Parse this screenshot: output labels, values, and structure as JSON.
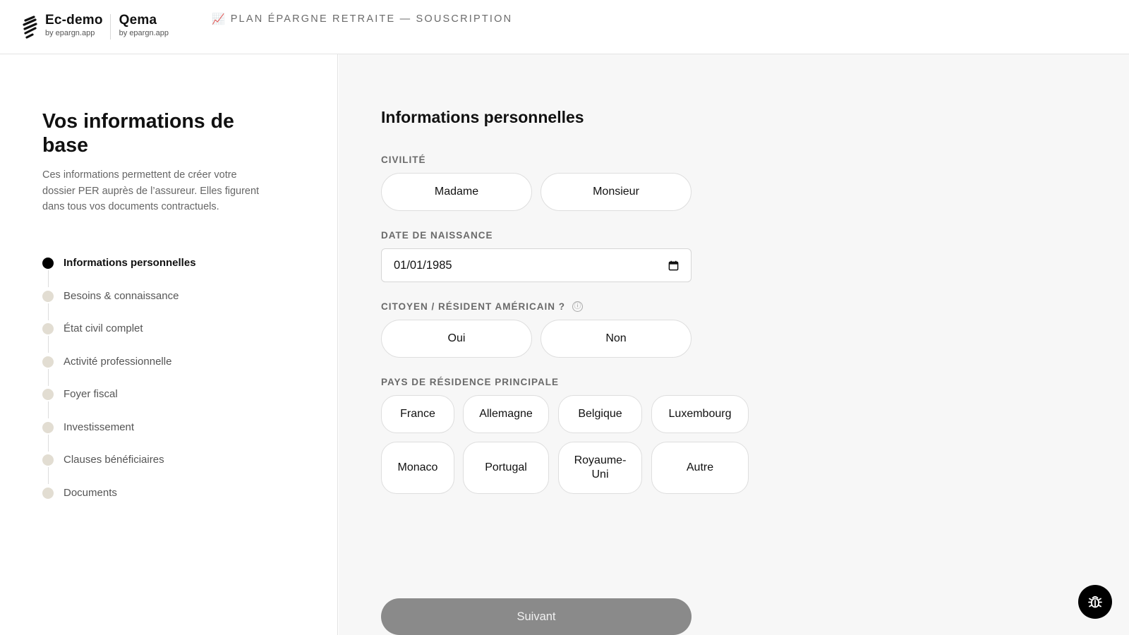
{
  "header": {
    "brand_1": {
      "name": "Ec-demo",
      "sub": "by epargn.app"
    },
    "brand_2": {
      "name": "Qema",
      "sub": "by epargn.app"
    },
    "product_icon": "📈",
    "product_title": "PLAN ÉPARGNE RETRAITE — SOUSCRIPTION"
  },
  "sidebar": {
    "title": "Vos informations de base",
    "description": "Ces informations permettent de créer votre dossier PER auprès de l’assureur. Elles figurent dans tous vos documents contractuels.",
    "steps": [
      {
        "label": "Informations personnelles",
        "active": true
      },
      {
        "label": "Besoins & connaissance",
        "active": false
      },
      {
        "label": "État civil complet",
        "active": false
      },
      {
        "label": "Activité professionnelle",
        "active": false
      },
      {
        "label": "Foyer fiscal",
        "active": false
      },
      {
        "label": "Investissement",
        "active": false
      },
      {
        "label": "Clauses bénéficiaires",
        "active": false
      },
      {
        "label": "Documents",
        "active": false
      }
    ]
  },
  "form": {
    "title": "Informations personnelles",
    "civilite": {
      "label": "CIVILITÉ",
      "options": [
        "Madame",
        "Monsieur"
      ]
    },
    "birth_date": {
      "label": "DATE DE NAISSANCE",
      "value": "01/01/1985"
    },
    "us_person": {
      "label": "CITOYEN / RÉSIDENT AMÉRICAIN ?",
      "info_icon": "ⓘ",
      "options": [
        "Oui",
        "Non"
      ]
    },
    "country": {
      "label": "PAYS DE RÉSIDENCE PRINCIPALE",
      "options": [
        "France",
        "Allemagne",
        "Belgique",
        "Luxembourg",
        "Monaco",
        "Portugal",
        "Royaume-Uni",
        "Autre"
      ]
    },
    "next_label": "Suivant"
  },
  "colors": {
    "accent": "#000000",
    "next_button_disabled": "#8a8a8a",
    "inactive_dot": "#e2ddd2",
    "right_panel_bg": "#f7f7f7"
  },
  "icons": {
    "logo": "brand-logo-icon",
    "calendar": "calendar-icon",
    "bug": "bug-icon"
  }
}
